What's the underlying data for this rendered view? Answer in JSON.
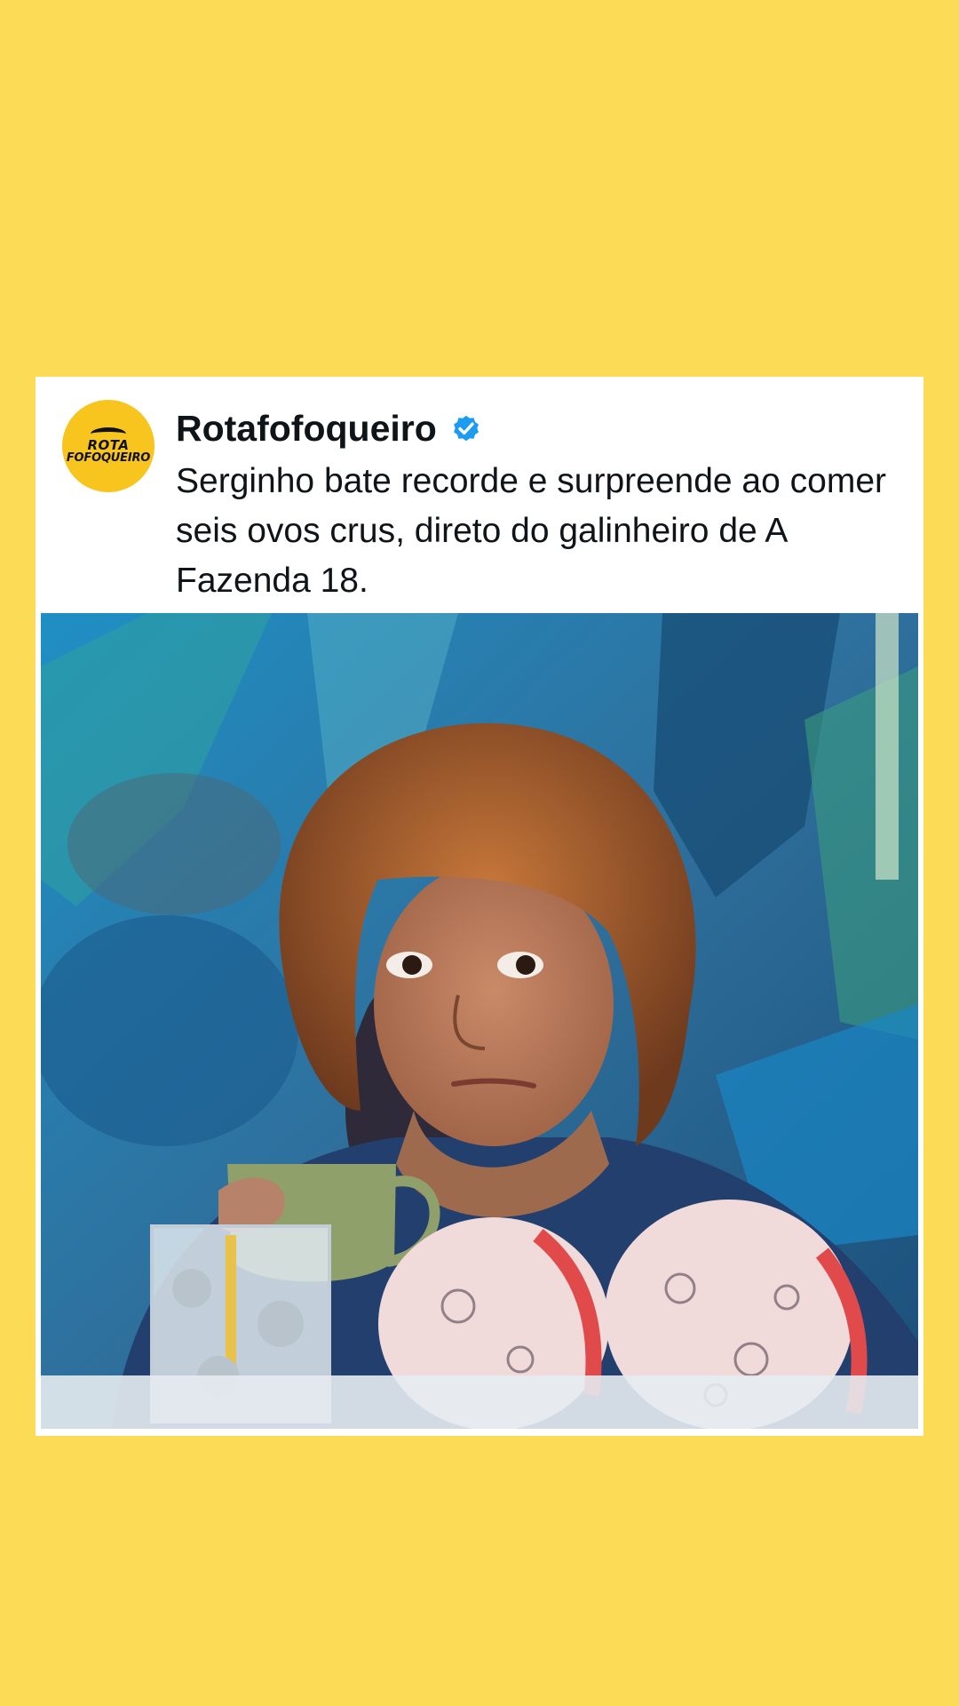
{
  "post": {
    "author": {
      "name": "Rotafofoqueiro",
      "verified": true,
      "avatar_text_line1": "ROTA",
      "avatar_text_line2": "FOFOQUEIRO"
    },
    "text": "Serginho bate recorde e surpreende ao comer seis ovos crus, direto do galinheiro de A Fazenda 18."
  },
  "colors": {
    "background": "#FCDB57",
    "card": "#FFFFFF",
    "verified_badge": "#1D9BF0",
    "avatar_bg": "#F7C51D"
  },
  "icons": {
    "verified": "verified-badge-icon"
  }
}
